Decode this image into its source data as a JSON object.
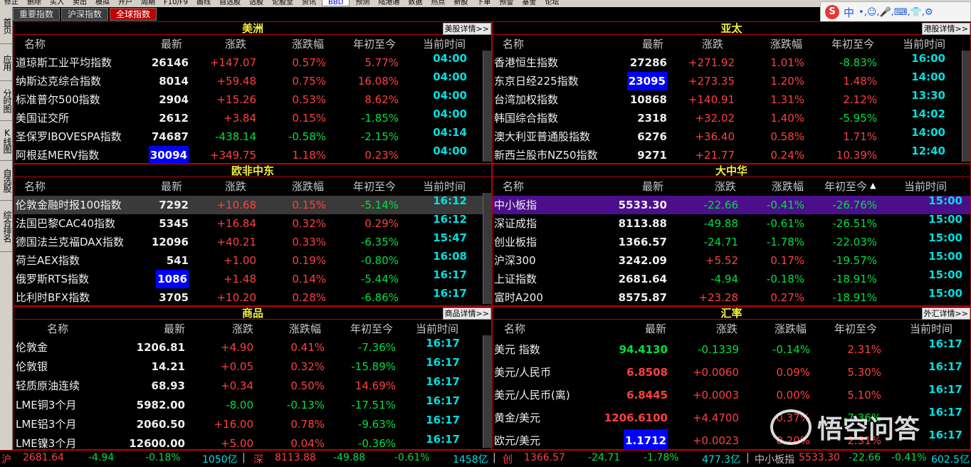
{
  "menubar": {
    "items": [
      "修正",
      "删除",
      "买入",
      "卖出",
      "模拟",
      "开户",
      "周期",
      "F10/F9",
      "画线",
      "自选股",
      "选股",
      "论股堂",
      "资讯",
      "预测",
      "陆港通",
      "数据",
      "热点",
      "新股",
      "下单",
      "预警",
      "基金",
      "论坛"
    ],
    "badge": "BBD"
  },
  "ime": {
    "label": "中",
    "extras": "•,☺,🎤,⌨,👕,⚙"
  },
  "tabs": [
    {
      "label": "重要指数"
    },
    {
      "label": "沪深指数"
    },
    {
      "label": "全球指数",
      "active": true
    }
  ],
  "sidebar": [
    "首页",
    "应用",
    "分时图",
    "K线图",
    "自选股",
    "综合排名"
  ],
  "columns": [
    "名称",
    "最新",
    "涨跌",
    "涨跌幅",
    "年初至今",
    "当前时间"
  ],
  "panels": {
    "americas": {
      "title": "美洲",
      "link": "美股详情>>",
      "rows": [
        {
          "name": "道琼斯工业平均指数",
          "last": "26146",
          "chg": "+147.07",
          "pct": "0.57%",
          "ytd": "5.77%",
          "time": "04:00",
          "dir": "up",
          "ydir": "up"
        },
        {
          "name": "纳斯达克综合指数",
          "last": "8014",
          "chg": "+59.48",
          "pct": "0.75%",
          "ytd": "16.08%",
          "time": "04:00",
          "dir": "up",
          "ydir": "up"
        },
        {
          "name": "标准普尔500指数",
          "last": "2904",
          "chg": "+15.26",
          "pct": "0.53%",
          "ytd": "8.62%",
          "time": "04:00",
          "dir": "up",
          "ydir": "up"
        },
        {
          "name": "美国证交所",
          "last": "2612",
          "chg": "+3.84",
          "pct": "0.15%",
          "ytd": "-1.85%",
          "time": "04:00",
          "dir": "up",
          "ydir": "down"
        },
        {
          "name": "圣保罗IBOVESPA指数",
          "last": "74687",
          "chg": "-438.14",
          "pct": "-0.58%",
          "ytd": "-2.15%",
          "time": "04:14",
          "dir": "down",
          "ydir": "down"
        },
        {
          "name": "阿根廷MERV指数",
          "last": "30094",
          "chg": "+349.75",
          "pct": "1.18%",
          "ytd": "0.23%",
          "time": "04:00",
          "dir": "up",
          "ydir": "up",
          "boxed": true
        }
      ]
    },
    "asia": {
      "title": "亚太",
      "link": "港股详情>>",
      "rows": [
        {
          "name": "香港恒生指数",
          "last": "27286",
          "chg": "+271.92",
          "pct": "1.01%",
          "ytd": "-8.83%",
          "time": "16:00",
          "dir": "up",
          "ydir": "down"
        },
        {
          "name": "东京日经225指数",
          "last": "23095",
          "chg": "+273.35",
          "pct": "1.20%",
          "ytd": "1.48%",
          "time": "14:00",
          "dir": "up",
          "ydir": "up",
          "boxed": true
        },
        {
          "name": "台湾加权指数",
          "last": "10868",
          "chg": "+140.91",
          "pct": "1.31%",
          "ytd": "2.12%",
          "time": "13:30",
          "dir": "up",
          "ydir": "up"
        },
        {
          "name": "韩国综合指数",
          "last": "2318",
          "chg": "+32.02",
          "pct": "1.40%",
          "ytd": "-5.95%",
          "time": "14:02",
          "dir": "up",
          "ydir": "down"
        },
        {
          "name": "澳大利亚普通股指数",
          "last": "6276",
          "chg": "+36.40",
          "pct": "0.58%",
          "ytd": "1.71%",
          "time": "14:00",
          "dir": "up",
          "ydir": "up"
        },
        {
          "name": "新西兰股市NZ50指数",
          "last": "9271",
          "chg": "+21.77",
          "pct": "0.24%",
          "ytd": "10.39%",
          "time": "12:40",
          "dir": "up",
          "ydir": "up"
        }
      ]
    },
    "emea": {
      "title": "欧非中东",
      "rows": [
        {
          "name": "伦敦金融时报100指数",
          "last": "7292",
          "chg": "+10.68",
          "pct": "0.15%",
          "ytd": "-5.14%",
          "time": "16:12",
          "dir": "up",
          "ydir": "down",
          "selected": true
        },
        {
          "name": "法国巴黎CAC40指数",
          "last": "5345",
          "chg": "+16.84",
          "pct": "0.32%",
          "ytd": "0.29%",
          "time": "16:12",
          "dir": "up",
          "ydir": "up"
        },
        {
          "name": "德国法兰克福DAX指数",
          "last": "12096",
          "chg": "+40.21",
          "pct": "0.33%",
          "ytd": "-6.35%",
          "time": "15:47",
          "dir": "up",
          "ydir": "down"
        },
        {
          "name": "荷兰AEX指数",
          "last": "541",
          "chg": "+1.00",
          "pct": "0.19%",
          "ytd": "-0.80%",
          "time": "16:08",
          "dir": "up",
          "ydir": "down"
        },
        {
          "name": "俄罗斯RTS指数",
          "last": "1086",
          "chg": "+1.48",
          "pct": "0.14%",
          "ytd": "-5.44%",
          "time": "16:17",
          "dir": "up",
          "ydir": "down",
          "boxed": true
        },
        {
          "name": "比利时BFX指数",
          "last": "3705",
          "chg": "+10.20",
          "pct": "0.28%",
          "ytd": "-6.86%",
          "time": "16:17",
          "dir": "up",
          "ydir": "down"
        }
      ]
    },
    "greater_china": {
      "title": "大中华",
      "sort_indicator": "▲",
      "rows": [
        {
          "name": "中小板指",
          "last": "5533.30",
          "chg": "-22.66",
          "pct": "-0.41%",
          "ytd": "-26.76%",
          "time": "15:00",
          "dir": "down",
          "ydir": "down",
          "highlight": true
        },
        {
          "name": "深证成指",
          "last": "8113.88",
          "chg": "-49.88",
          "pct": "-0.61%",
          "ytd": "-26.51%",
          "time": "15:00",
          "dir": "down",
          "ydir": "down"
        },
        {
          "name": "创业板指",
          "last": "1366.57",
          "chg": "-24.71",
          "pct": "-1.78%",
          "ytd": "-22.03%",
          "time": "15:00",
          "dir": "down",
          "ydir": "down"
        },
        {
          "name": "沪深300",
          "last": "3242.09",
          "chg": "+5.52",
          "pct": "0.17%",
          "ytd": "-19.57%",
          "time": "15:00",
          "dir": "up",
          "ydir": "down"
        },
        {
          "name": "上证指数",
          "last": "2681.64",
          "chg": "-4.94",
          "pct": "-0.18%",
          "ytd": "-18.91%",
          "time": "15:00",
          "dir": "down",
          "ydir": "down"
        },
        {
          "name": "富时A200",
          "last": "8575.87",
          "chg": "+23.28",
          "pct": "0.27%",
          "ytd": "-18.91%",
          "time": "15:00",
          "dir": "up",
          "ydir": "down"
        }
      ]
    },
    "commodities": {
      "title": "商品",
      "link": "商品详情>>",
      "rows": [
        {
          "name": "伦敦金",
          "last": "1206.81",
          "chg": "+4.90",
          "pct": "0.41%",
          "ytd": "-7.36%",
          "time": "16:17",
          "dir": "up",
          "ydir": "down"
        },
        {
          "name": "伦敦银",
          "last": "14.21",
          "chg": "+0.05",
          "pct": "0.32%",
          "ytd": "-15.89%",
          "time": "16:17",
          "dir": "up",
          "ydir": "down"
        },
        {
          "name": "轻质原油连续",
          "last": "68.93",
          "chg": "+0.34",
          "pct": "0.50%",
          "ytd": "14.69%",
          "time": "16:17",
          "dir": "up",
          "ydir": "up"
        },
        {
          "name": "LME铜3个月",
          "last": "5982.00",
          "chg": "-8.00",
          "pct": "-0.13%",
          "ytd": "-17.51%",
          "time": "16:17",
          "dir": "down",
          "ydir": "down"
        },
        {
          "name": "LME铝3个月",
          "last": "2060.50",
          "chg": "+16.00",
          "pct": "0.78%",
          "ytd": "-9.63%",
          "time": "16:17",
          "dir": "up",
          "ydir": "down"
        },
        {
          "name": "LME镍3个月",
          "last": "12600.00",
          "chg": "+5.00",
          "pct": "0.04%",
          "ytd": "-0.36%",
          "time": "16:17",
          "dir": "up",
          "ydir": "down"
        }
      ]
    },
    "fx": {
      "title": "汇率",
      "link": "外汇详情>>",
      "rows": [
        {
          "name": "美元 指数",
          "last": "94.4130",
          "chg": "-0.1339",
          "pct": "-0.14%",
          "ytd": "2.31%",
          "time": "16:17",
          "dir": "down",
          "ydir": "up",
          "lastcolor": "green"
        },
        {
          "name": "美元/人民币",
          "last": "6.8508",
          "chg": "+0.0060",
          "pct": "0.09%",
          "ytd": "5.30%",
          "time": "16:17",
          "dir": "up",
          "ydir": "up",
          "lastcolor": "red"
        },
        {
          "name": "美元/人民币(离)",
          "last": "6.8445",
          "chg": "+0.0003",
          "pct": "0.00%",
          "ytd": "5.10%",
          "time": "16:17",
          "dir": "up",
          "ydir": "up",
          "lastcolor": "red"
        },
        {
          "name": "黄金/美元",
          "last": "1206.6100",
          "chg": "+4.4700",
          "pct": "0.37%",
          "ytd": "-7.36%",
          "time": "16:17",
          "dir": "up",
          "ydir": "down",
          "lastcolor": "red"
        },
        {
          "name": "欧元/美元",
          "last": "1.1712",
          "chg": "+0.0023",
          "pct": "0.20%",
          "ytd": "2.31%",
          "time": "16:17",
          "dir": "up",
          "ydir": "up",
          "lastcolor": "red",
          "boxed": true
        }
      ]
    }
  },
  "statusbar": {
    "sh": {
      "label": "沪",
      "value": "2681.64",
      "chg": "-4.94",
      "pct": "-0.18%",
      "amt": "1050亿"
    },
    "sz": {
      "label": "深",
      "value": "8113.88",
      "chg": "-49.88",
      "pct": "-0.61%",
      "amt": "1458亿"
    },
    "cy": {
      "label": "创",
      "value": "1366.57",
      "chg": "-24.71",
      "pct": "-1.78%",
      "amt": "477.3亿"
    },
    "zx": {
      "label": "中小板指",
      "value": "5533.30",
      "chg": "-22.66",
      "pct": "-0.41%",
      "amt": "602.5亿"
    }
  },
  "watermark": {
    "text": "悟空问答"
  }
}
